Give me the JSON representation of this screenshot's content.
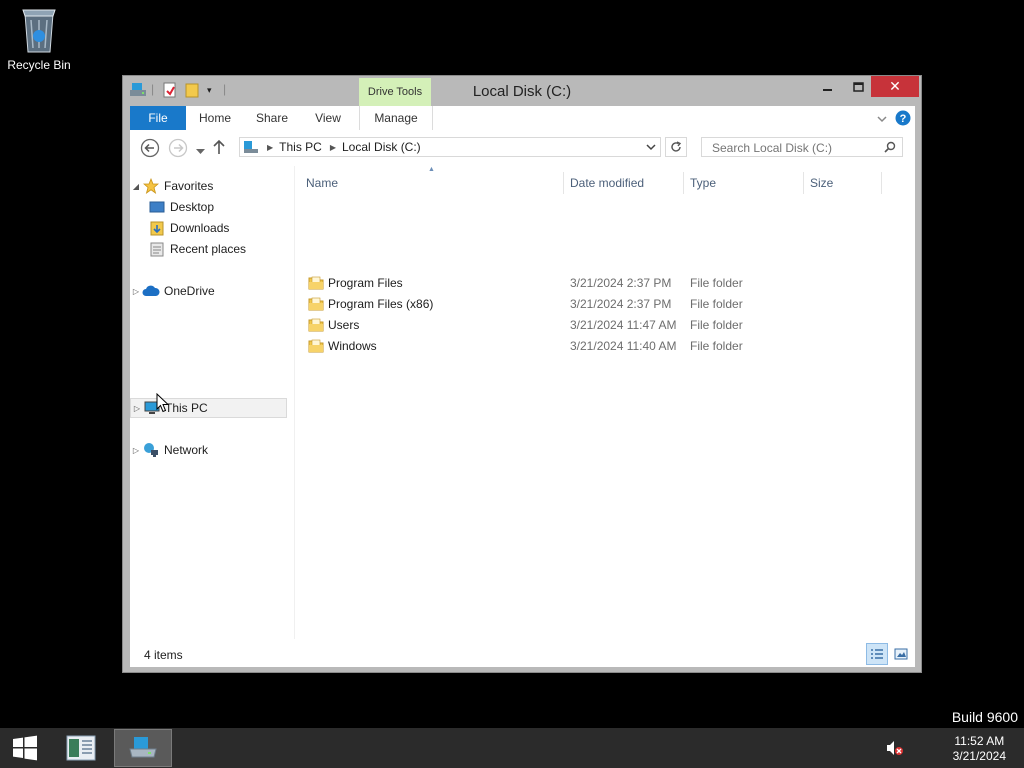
{
  "desktop": {
    "recycle_bin_label": "Recycle Bin",
    "build_label": "Build 9600"
  },
  "taskbar": {
    "clock_time": "11:52 AM",
    "clock_date": "3/21/2024"
  },
  "window": {
    "title": "Local Disk (C:)",
    "contextual_tab": "Drive Tools",
    "ribbon_tabs": {
      "file": "File",
      "home": "Home",
      "share": "Share",
      "view": "View",
      "manage": "Manage"
    },
    "breadcrumb": [
      "This PC",
      "Local Disk (C:)"
    ],
    "search_placeholder": "Search Local Disk (C:)",
    "nav": {
      "favorites": "Favorites",
      "desktop": "Desktop",
      "downloads": "Downloads",
      "recent": "Recent places",
      "onedrive": "OneDrive",
      "thispc": "This PC",
      "network": "Network"
    },
    "columns": {
      "name": "Name",
      "date": "Date modified",
      "type": "Type",
      "size": "Size"
    },
    "files": [
      {
        "name": "Program Files",
        "date": "3/21/2024 2:37 PM",
        "type": "File folder"
      },
      {
        "name": "Program Files (x86)",
        "date": "3/21/2024 2:37 PM",
        "type": "File folder"
      },
      {
        "name": "Users",
        "date": "3/21/2024 11:47 AM",
        "type": "File folder"
      },
      {
        "name": "Windows",
        "date": "3/21/2024 11:40 AM",
        "type": "File folder"
      }
    ],
    "status_count": "4 items"
  },
  "colors": {
    "accent": "#1979ca",
    "drive_tools": "#d4f0b8",
    "close": "#c7333a",
    "taskbar": "#2b2b2b"
  }
}
